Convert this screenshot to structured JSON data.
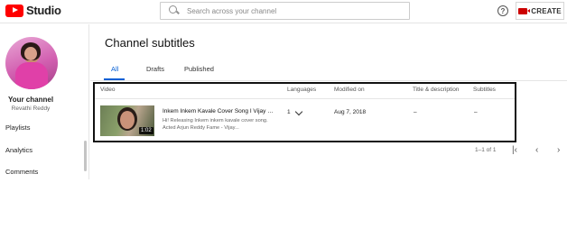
{
  "header": {
    "logo_text": "Studio",
    "search_placeholder": "Search across your channel",
    "help_glyph": "?",
    "create_label": "CREATE",
    "brand_color": "#ff0000"
  },
  "sidebar": {
    "channel_title": "Your channel",
    "channel_user": "Revathi Reddy",
    "items": [
      {
        "label": "Playlists"
      },
      {
        "label": "Analytics"
      },
      {
        "label": "Comments"
      }
    ]
  },
  "main": {
    "title": "Channel subtitles",
    "tabs": [
      {
        "label": "All",
        "active": true
      },
      {
        "label": "Drafts",
        "active": false
      },
      {
        "label": "Published",
        "active": false
      }
    ],
    "accent_color": "#065fd4",
    "columns": [
      "Video",
      "Languages",
      "Modified on",
      "Title & description",
      "Subtitles"
    ],
    "rows": [
      {
        "title": "Inkem Inkem Kavale Cover Song I Vijay D...",
        "description": "Hi! Releasing Inkem inkem kavale cover song. Acted Arjun Reddy Fame - Vijay...",
        "duration": "1:02",
        "languages": "1",
        "modified_on": "Aug 7, 2018",
        "title_desc": "–",
        "subtitles": "–"
      }
    ],
    "pagination": {
      "range_text": "1–1 of 1",
      "first": "|‹",
      "prev": "‹",
      "next": "›"
    }
  }
}
